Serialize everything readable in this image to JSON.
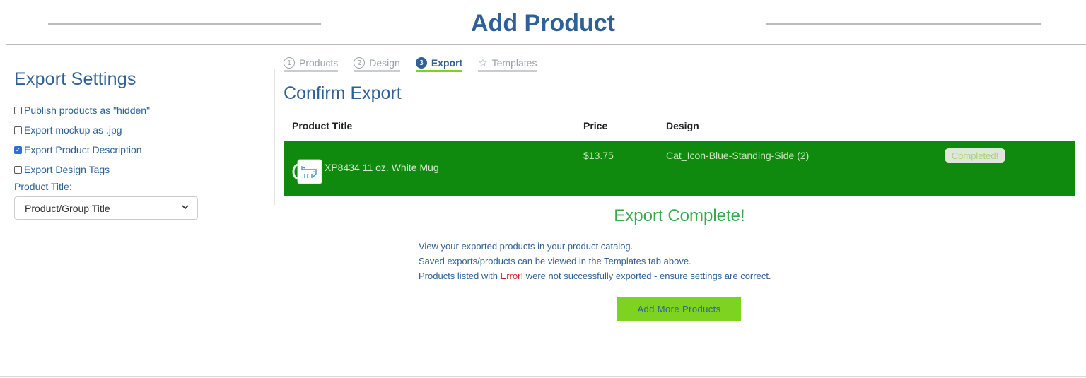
{
  "header": {
    "title": "Add Product"
  },
  "settings": {
    "title": "Export Settings",
    "options": [
      {
        "label": "Publish products as \"hidden\"",
        "checked": false
      },
      {
        "label": "Export mockup as .jpg",
        "checked": false
      },
      {
        "label": "Export Product Description",
        "checked": true
      },
      {
        "label": "Export Design Tags",
        "checked": false
      }
    ],
    "product_title_label": "Product Title:",
    "product_title_value": "Product/Group Title"
  },
  "tabs": [
    {
      "num": "1",
      "label": "Products",
      "active": false
    },
    {
      "num": "2",
      "label": "Design",
      "active": false
    },
    {
      "num": "3",
      "label": "Export",
      "active": true
    },
    {
      "icon": "star-icon",
      "label": "Templates",
      "active": false
    }
  ],
  "confirm": {
    "title": "Confirm Export"
  },
  "table": {
    "headers": [
      "Product Title",
      "Price",
      "Design"
    ],
    "rows": [
      {
        "name": "XP8434 11 oz. White Mug",
        "price": "$13.75",
        "design": "Cat_Icon-Blue-Standing-Side (2)",
        "status": "Completed!"
      }
    ]
  },
  "result": {
    "title": "Export Complete!",
    "line1": "View your exported products in your product catalog.",
    "line2": "Saved exports/products can be viewed in the Templates tab above.",
    "line3_pre": "Products listed with ",
    "line3_err": "Error!",
    "line3_post": " were not successfully exported - ensure settings are correct.",
    "button": "Add More Products"
  },
  "colors": {
    "brand": "#2f6196",
    "accent_green": "#7ed321",
    "row_green": "#0f8a0f",
    "success": "#3aa84c",
    "error": "#d0232b"
  }
}
